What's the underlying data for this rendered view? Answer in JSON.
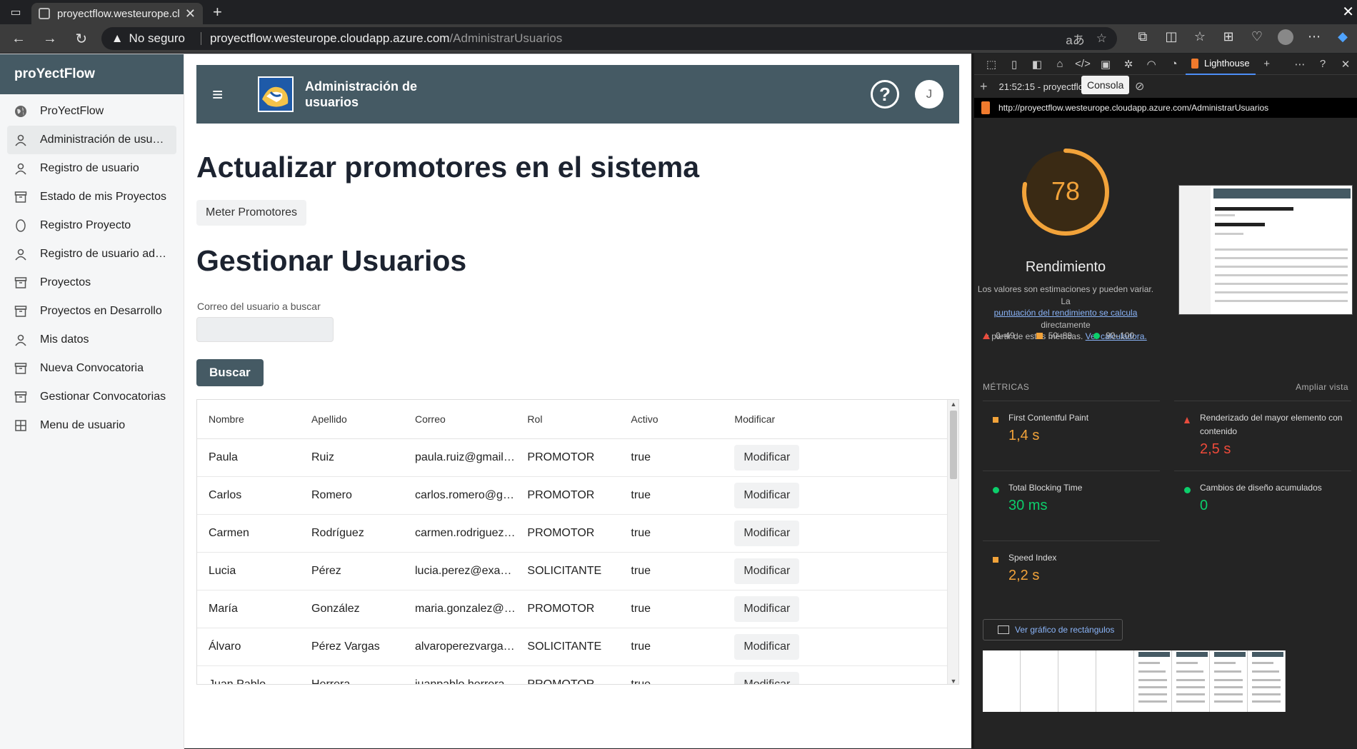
{
  "browser": {
    "tab_title": "proyectflow.westeurope.cl",
    "insecure_label": "No seguro",
    "url_host": "proyectflow.westeurope.cloudapp.azure.com",
    "url_path": "/AdministrarUsuarios"
  },
  "sidebar": {
    "brand": "proYectFlow",
    "items": [
      {
        "label": "ProYectFlow",
        "icon": "globe-icon"
      },
      {
        "label": "Administración de usu…",
        "icon": "person-icon",
        "active": true
      },
      {
        "label": "Registro de usuario",
        "icon": "person-icon"
      },
      {
        "label": "Estado de mis Proyectos",
        "icon": "archive-icon"
      },
      {
        "label": "Registro Proyecto",
        "icon": "oval-icon"
      },
      {
        "label": "Registro de usuario ad…",
        "icon": "person-icon"
      },
      {
        "label": "Proyectos",
        "icon": "archive-icon"
      },
      {
        "label": "Proyectos en Desarrollo",
        "icon": "archive-icon"
      },
      {
        "label": "Mis datos",
        "icon": "person-icon"
      },
      {
        "label": "Nueva Convocatoria",
        "icon": "archive-icon"
      },
      {
        "label": "Gestionar Convocatorias",
        "icon": "archive-icon"
      },
      {
        "label": "Menu de usuario",
        "icon": "grid-icon"
      }
    ]
  },
  "header": {
    "title": "Administración de usuarios",
    "help": "?",
    "user_initial": "J"
  },
  "main": {
    "heading_promotores": "Actualizar promotores en el sistema",
    "btn_meter": "Meter Promotores",
    "heading_usuarios": "Gestionar Usuarios",
    "search_label": "Correo del usuario a buscar",
    "search_value": "",
    "btn_buscar": "Buscar"
  },
  "table": {
    "columns": [
      "Nombre",
      "Apellido",
      "Correo",
      "Rol",
      "Activo",
      "Modificar"
    ],
    "button_label": "Modificar",
    "rows": [
      {
        "nombre": "Paula",
        "apellido": "Ruiz",
        "correo": "paula.ruiz@gmail…",
        "rol": "PROMOTOR",
        "activo": "true"
      },
      {
        "nombre": "Carlos",
        "apellido": "Romero",
        "correo": "carlos.romero@g…",
        "rol": "PROMOTOR",
        "activo": "true"
      },
      {
        "nombre": "Carmen",
        "apellido": "Rodríguez",
        "correo": "carmen.rodriguez…",
        "rol": "PROMOTOR",
        "activo": "true"
      },
      {
        "nombre": "Lucia",
        "apellido": "Pérez",
        "correo": "lucia.perez@exa…",
        "rol": "SOLICITANTE",
        "activo": "true"
      },
      {
        "nombre": "María",
        "apellido": "González",
        "correo": "maria.gonzalez@…",
        "rol": "PROMOTOR",
        "activo": "true"
      },
      {
        "nombre": "Álvaro",
        "apellido": "Pérez Vargas",
        "correo": "alvaroperezvarga…",
        "rol": "SOLICITANTE",
        "activo": "true"
      },
      {
        "nombre": "Juan Pablo",
        "apellido": "Herrera",
        "correo": "juanpablo.herrera…",
        "rol": "PROMOTOR",
        "activo": "true"
      }
    ]
  },
  "devtools": {
    "tab_lighthouse": "Lighthouse",
    "tooltip": "Consola",
    "report_time": "21:52:15 - proyectflo",
    "report_url": "http://proyectflow.westeurope.cloudapp.azure.com/AdministrarUsuarios",
    "score": 78,
    "score_text": "78",
    "score_color": "#f2a33a",
    "category": "Rendimiento",
    "desc_1": "Los valores son estimaciones y pueden variar. La",
    "desc_link_1": "puntuación del rendimiento se calcula",
    "desc_2": "directamente",
    "desc_3": "a partir de estas métricas.",
    "desc_link_2": "Ver calculadora.",
    "legend": [
      "0–49",
      "50–89",
      "90–100"
    ],
    "metrics_title": "MÉTRICAS",
    "expand_view": "Ampliar vista",
    "metrics": [
      {
        "name": "First Contentful Paint",
        "value": "1,4 s",
        "status": "average"
      },
      {
        "name": "Renderizado del mayor elemento con contenido",
        "value": "2,5 s",
        "status": "fail"
      },
      {
        "name": "Total Blocking Time",
        "value": "30 ms",
        "status": "pass"
      },
      {
        "name": "Cambios de diseño acumulados",
        "value": "0",
        "status": "pass"
      },
      {
        "name": "Speed Index",
        "value": "2,2 s",
        "status": "average"
      }
    ],
    "treemap_button": "Ver gráfico de rectángulos"
  }
}
